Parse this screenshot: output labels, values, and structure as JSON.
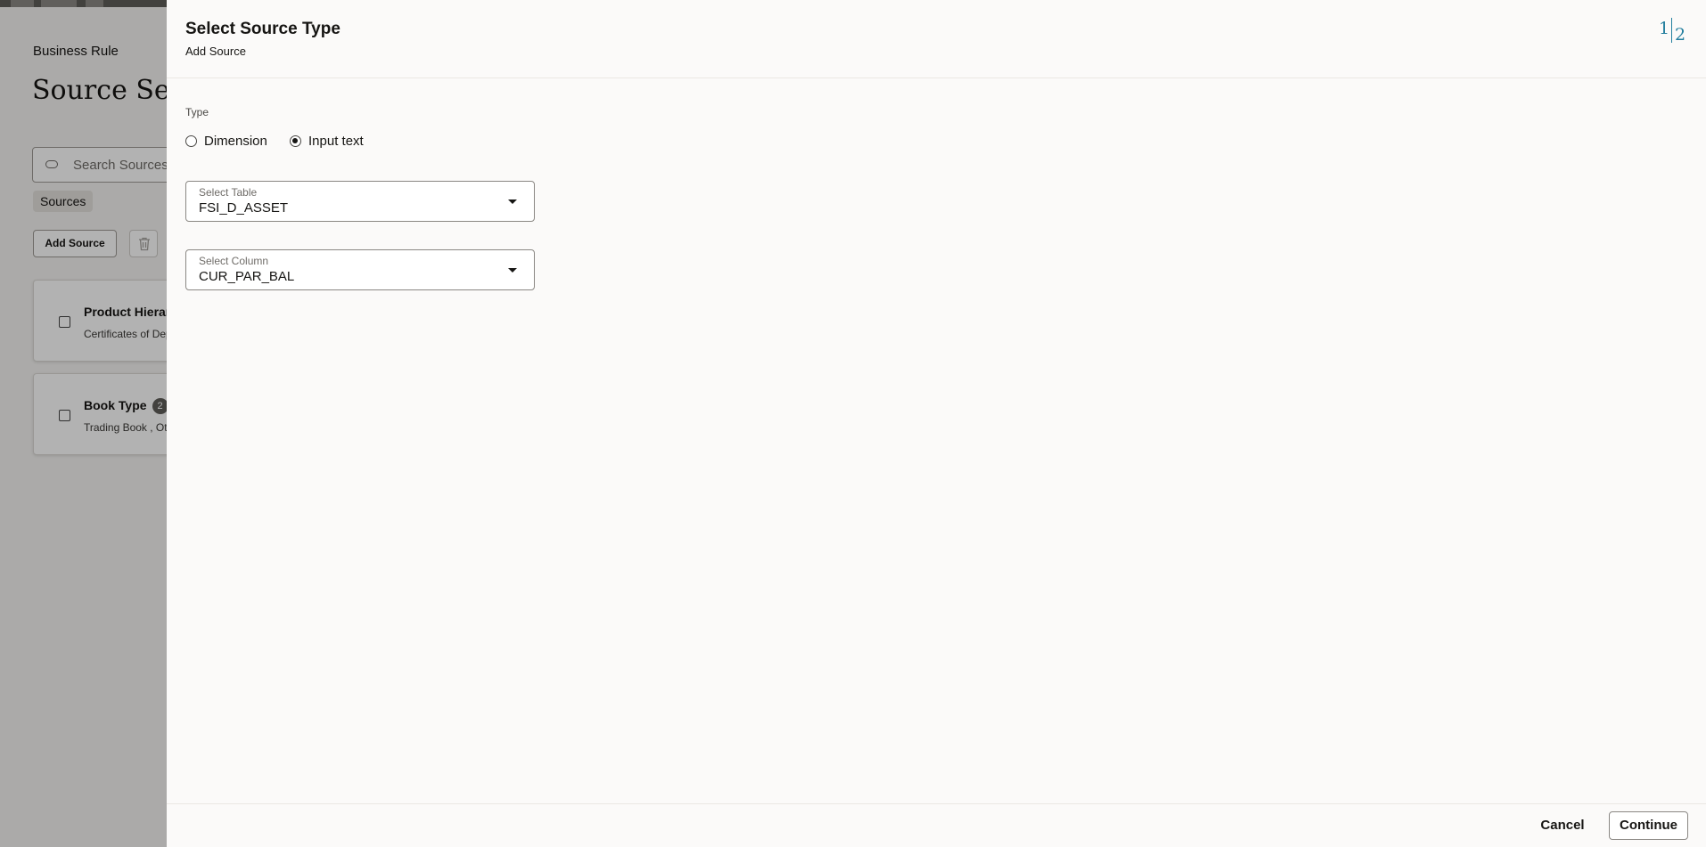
{
  "background": {
    "breadcrumb": "Business Rule",
    "page_title": "Source Setup",
    "search": {
      "placeholder": "Search Sources",
      "icon": "search-icon"
    },
    "filter_chip": "Sources",
    "add_source_label": "Add Source",
    "delete_icon": "trash-icon",
    "cards": [
      {
        "title": "Product Hierarchy",
        "subtitle": "Certificates of Deposit"
      },
      {
        "title": "Book Type",
        "badge": "2",
        "subtitle": "Trading Book , Other"
      }
    ]
  },
  "drawer": {
    "title": "Select Source Type",
    "subtitle": "Add Source",
    "steps": {
      "current": "1",
      "total": "2"
    },
    "type_label": "Type",
    "type_options": [
      {
        "label": "Dimension",
        "selected": false
      },
      {
        "label": "Input text",
        "selected": true
      }
    ],
    "select_table": {
      "label": "Select Table",
      "value": "FSI_D_ASSET",
      "icon": "caret-down-icon"
    },
    "select_column": {
      "label": "Select Column",
      "value": "CUR_PAR_BAL",
      "icon": "caret-down-icon"
    },
    "footer": {
      "cancel_label": "Cancel",
      "continue_label": "Continue"
    }
  },
  "colors": {
    "accent": "#227e9e",
    "overlay": "rgba(0,0,0,0.30)",
    "drawer_bg": "#fbfaf9",
    "text": "#161513"
  }
}
